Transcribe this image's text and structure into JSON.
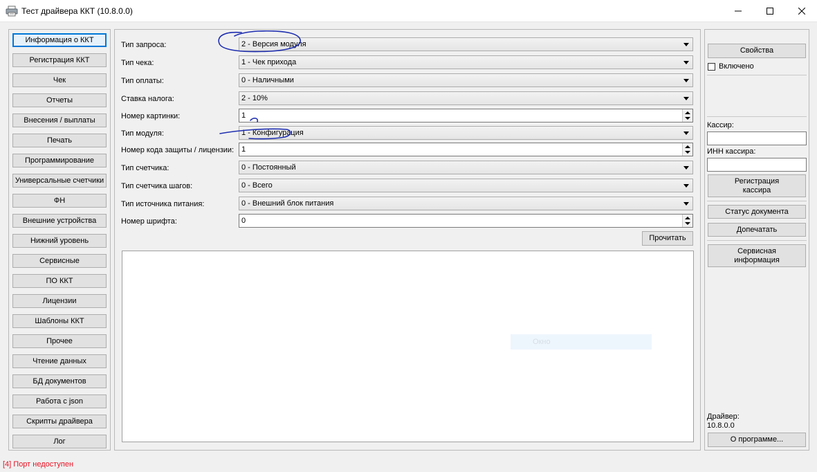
{
  "window": {
    "title": "Тест драйвера ККТ (10.8.0.0)"
  },
  "nav": [
    "Информация о ККТ",
    "Регистрация ККТ",
    "Чек",
    "Отчеты",
    "Внесения / выплаты",
    "Печать",
    "Программирование",
    "Универсальные счетчики",
    "ФН",
    "Внешние устройства",
    "Нижний уровень",
    "Сервисные",
    "ПО ККТ",
    "Лицензии",
    "Шаблоны ККТ",
    "Прочее",
    "Чтение данных",
    "БД документов",
    "Работа с json",
    "Скрипты драйвера",
    "Лог"
  ],
  "form": {
    "request_type": {
      "label": "Тип запроса:",
      "value": "2 - Версия модуля"
    },
    "receipt_type": {
      "label": "Тип чека:",
      "value": "1 - Чек прихода"
    },
    "payment_type": {
      "label": "Тип оплаты:",
      "value": "0 - Наличными"
    },
    "tax_rate": {
      "label": "Ставка налога:",
      "value": "2 - 10%"
    },
    "picture_number": {
      "label": "Номер картинки:",
      "value": "1"
    },
    "module_type": {
      "label": "Тип модуля:",
      "value": "1 - Конфигурация"
    },
    "protection_code": {
      "label": "Номер кода защиты / лицензии:",
      "value": "1"
    },
    "counter_type": {
      "label": "Тип счетчика:",
      "value": "0 - Постоянный"
    },
    "step_counter_type": {
      "label": "Тип счетчика шагов:",
      "value": "0 - Всего"
    },
    "power_source_type": {
      "label": "Тип источника питания:",
      "value": "0 - Внешний блок питания"
    },
    "font_number": {
      "label": "Номер шрифта:",
      "value": "0"
    },
    "read_button": "Прочитать",
    "watermark": "Окно"
  },
  "right": {
    "properties_button": "Свойства",
    "enabled_label": "Включено",
    "cashier_label": "Кассир:",
    "cashier_inn_label": "ИНН кассира:",
    "register_cashier_line1": "Регистрация",
    "register_cashier_line2": "кассира",
    "doc_status_button": "Статус документа",
    "reprint_button": "Допечатать",
    "service_info_line1": "Сервисная",
    "service_info_line2": "информация",
    "driver_label": "Драйвер:",
    "driver_version": "10.8.0.0",
    "about_button": "О программе..."
  },
  "status": {
    "text": "[4] Порт недоступен",
    "color": "#e81123"
  },
  "colors": {
    "accent": "#0078d7",
    "annotation_ink": "#1f2fb0"
  },
  "icons": {
    "app": "printer-icon",
    "minimize": "minimize-icon",
    "maximize": "maximize-icon",
    "close": "close-icon"
  }
}
